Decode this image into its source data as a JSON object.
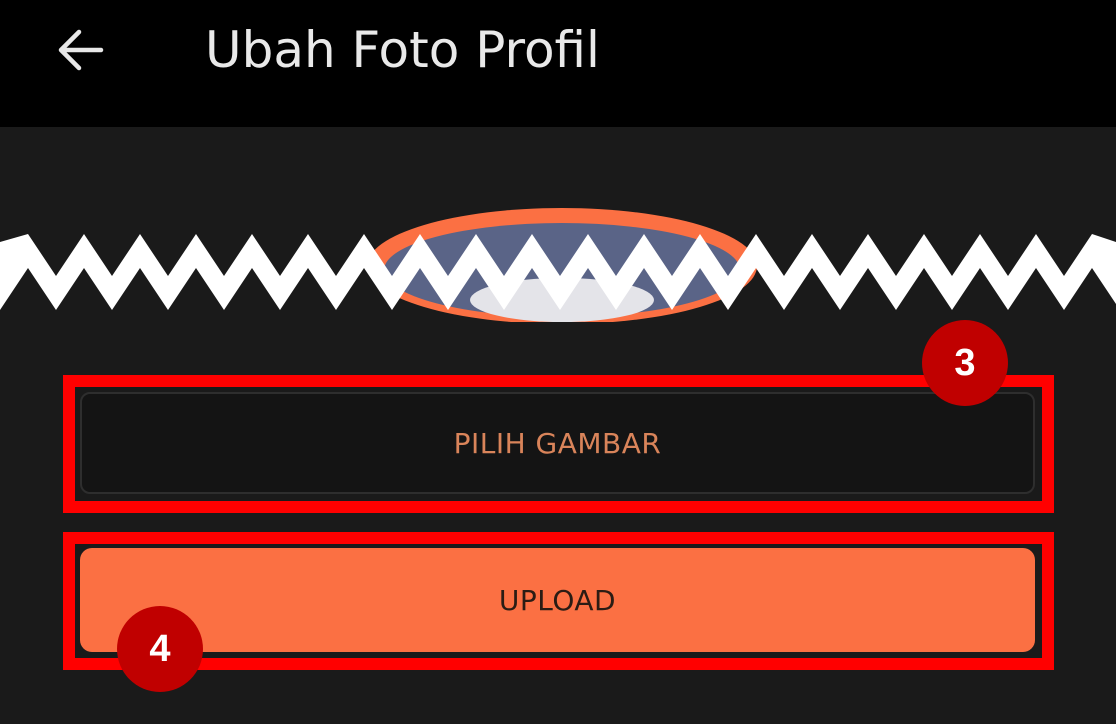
{
  "header": {
    "title": "Ubah Foto Profil",
    "back_icon": "arrow-left-icon"
  },
  "avatar": {
    "icon": "profile-photo-placeholder",
    "ring_color": "#fb7043",
    "fill_color": "#5a6487"
  },
  "actions": {
    "pick_image_label": "PILIH GAMBAR",
    "upload_label": "UPLOAD"
  },
  "annotations": {
    "step_3": "3",
    "step_4": "4"
  },
  "colors": {
    "accent": "#fb7043",
    "highlight": "#ff0000",
    "marker": "#c00000"
  }
}
